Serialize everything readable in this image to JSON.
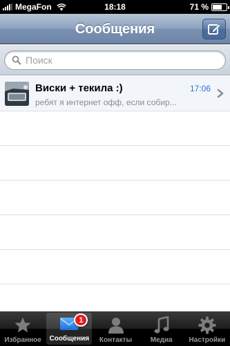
{
  "status_bar": {
    "carrier": "MegaFon",
    "time": "18:18",
    "battery_text": "71 %",
    "battery_level": 0.71
  },
  "nav": {
    "title": "Сообщения",
    "compose_icon": "compose-icon"
  },
  "search": {
    "placeholder": "Поиск"
  },
  "conversations": [
    {
      "name": "Виски + текила :)",
      "time": "17:06",
      "preview": "ребят я интернет офф, если собир..."
    }
  ],
  "tabs": [
    {
      "label": "Избранное",
      "icon": "star-icon",
      "active": false
    },
    {
      "label": "Сообщения",
      "icon": "envelope-icon",
      "active": true,
      "badge": "1"
    },
    {
      "label": "Контакты",
      "icon": "person-icon",
      "active": false
    },
    {
      "label": "Медиа",
      "icon": "music-note-icon",
      "active": false
    },
    {
      "label": "Настройки",
      "icon": "gear-icon",
      "active": false
    }
  ],
  "colors": {
    "accent_time": "#2f6fd0",
    "badge": "#e41c1c",
    "nav_bar": "#7b91b1"
  }
}
